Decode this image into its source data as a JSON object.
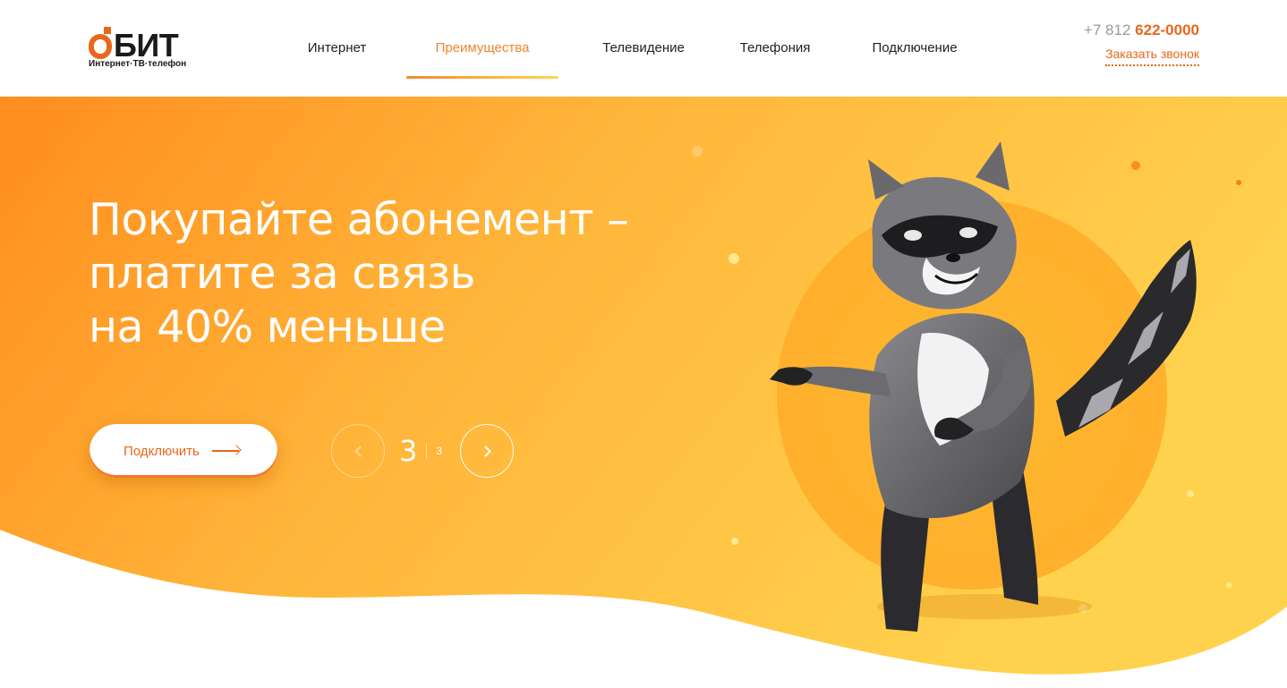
{
  "logo": {
    "brand": "БИТ",
    "tagline": "Интернет·ТВ·телефон"
  },
  "nav": {
    "items": [
      {
        "label": "Интернет"
      },
      {
        "label": "Преимущества",
        "active": true
      },
      {
        "label": "Телевидение"
      },
      {
        "label": "Телефония"
      },
      {
        "label": "Подключение"
      }
    ]
  },
  "contact": {
    "phone_prefix": "+7 812",
    "phone_number": "622-0000",
    "callback_label": "Заказать звонок"
  },
  "hero": {
    "headline_lines": [
      "Покупайте абонемент –",
      "платите за связь",
      "на 40% меньше"
    ],
    "cta_label": "Подключить",
    "slider": {
      "current": "3",
      "total": "3"
    },
    "mascot_icon": "raccoon-mascot"
  },
  "colors": {
    "accent": "#e8671c",
    "gradient_start": "#ff8f1f",
    "gradient_end": "#ffd04a",
    "text_dark": "#222222"
  },
  "icons": {
    "prev": "chevron-left-icon",
    "next": "chevron-right-icon",
    "cta_arrow": "arrow-right-icon"
  }
}
